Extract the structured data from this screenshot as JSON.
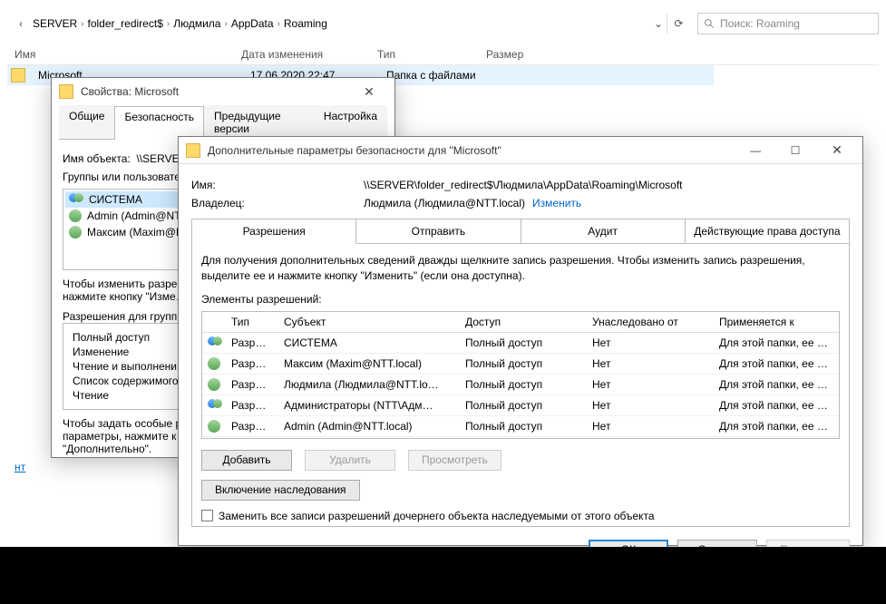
{
  "breadcrumb": {
    "items": [
      "SERVER",
      "folder_redirect$",
      "Людмила",
      "AppData",
      "Roaming"
    ]
  },
  "search": {
    "placeholder": "Поиск: Roaming"
  },
  "columns": {
    "name": "Имя",
    "date": "Дата изменения",
    "type": "Тип",
    "size": "Размер"
  },
  "file_row": {
    "name": "Microsoft",
    "date": "17.06.2020 22:47",
    "type": "Папка с файлами"
  },
  "left_link": "нт",
  "properties": {
    "title": "Свойства: Microsoft",
    "tabs": [
      "Общие",
      "Безопасность",
      "Предыдущие версии",
      "Настройка"
    ],
    "active_tab": 1,
    "object_label": "Имя объекта:",
    "object_value": "\\\\SERVER\\f…",
    "groups_label": "Группы или пользовате…",
    "groups": [
      "СИСТЕМА",
      "Admin (Admin@NTT…",
      "Максим (Maxim@N…"
    ],
    "hint1": "Чтобы изменить разре…",
    "hint2": "нажмите кнопку \"Изме…",
    "perm_for": "Разрешения для групп…",
    "perms": [
      "Полный доступ",
      "Изменение",
      "Чтение и выполнени…",
      "Список содержимого…",
      "Чтение"
    ],
    "foot1": "Чтобы задать особые р…",
    "foot2": "параметры, нажмите к…",
    "foot3": "\"Дополнительно\"."
  },
  "advanced": {
    "title": "Дополнительные параметры безопасности для \"Microsoft\"",
    "name_label": "Имя:",
    "name_value": "\\\\SERVER\\folder_redirect$\\Людмила\\AppData\\Roaming\\Microsoft",
    "owner_label": "Владелец:",
    "owner_value": "Людмила (Людмила@NTT.local)",
    "owner_change": "Изменить",
    "tabs": [
      "Разрешения",
      "Отправить",
      "Аудит",
      "Действующие права доступа"
    ],
    "active_tab": 0,
    "info": "Для получения дополнительных сведений дважды щелкните запись разрешения. Чтобы изменить запись разрешения, выделите ее и нажмите кнопку \"Изменить\" (если она доступна).",
    "elements_label": "Элементы разрешений:",
    "headers": {
      "type": "Тип",
      "subject": "Субъект",
      "access": "Доступ",
      "inherited": "Унаследовано от",
      "applies": "Применяется к"
    },
    "rows": [
      {
        "icon": "group",
        "type": "Разр…",
        "subject": "СИСТЕМА",
        "access": "Полный доступ",
        "inherited": "Нет",
        "applies": "Для этой папки, ее подпапок …"
      },
      {
        "icon": "user",
        "type": "Разр…",
        "subject": "Максим (Maxim@NTT.local)",
        "access": "Полный доступ",
        "inherited": "Нет",
        "applies": "Для этой папки, ее подпапок …"
      },
      {
        "icon": "user",
        "type": "Разр…",
        "subject": "Людмила (Людмила@NTT.lo…",
        "access": "Полный доступ",
        "inherited": "Нет",
        "applies": "Для этой папки, ее подпапок …"
      },
      {
        "icon": "group",
        "type": "Разр…",
        "subject": "Администраторы (NTT\\Адм…",
        "access": "Полный доступ",
        "inherited": "Нет",
        "applies": "Для этой папки, ее подпапок …"
      },
      {
        "icon": "user",
        "type": "Разр…",
        "subject": "Admin (Admin@NTT.local)",
        "access": "Полный доступ",
        "inherited": "Нет",
        "applies": "Для этой папки, ее подпапок …"
      }
    ],
    "buttons": {
      "add": "Добавить",
      "remove": "Удалить",
      "view": "Просмотреть",
      "enable_inh": "Включение наследования"
    },
    "replace_checkbox": "Заменить все записи разрешений дочернего объекта наследуемыми от этого объекта",
    "footer": {
      "ok": "ОК",
      "cancel": "Отмена",
      "apply": "Применить"
    }
  }
}
